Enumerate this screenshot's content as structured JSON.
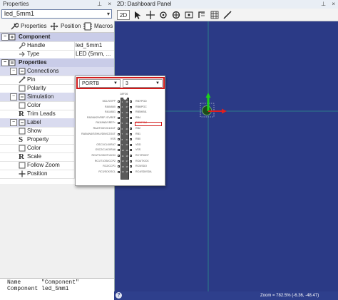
{
  "properties_panel": {
    "title": "Properties",
    "pin_icon": "pin-icon",
    "close_icon": "close-icon",
    "selected_component": "led_5mm1",
    "toolbar": {
      "properties_label": "Properties",
      "position_label": "Position",
      "macros_label": "Macros"
    },
    "rows": {
      "component": "Component",
      "handle_label": "Handle",
      "handle_value": "led_5mm1",
      "type_label": "Type",
      "type_value": "LED (5mm, ...",
      "properties": "Properties",
      "connections": "Connections",
      "pin": "Pin",
      "polarity": "Polarity",
      "simulation": "Simulation",
      "color": "Color",
      "trim_leads": "Trim Leads",
      "label": "Label",
      "show": "Show",
      "property": "Property",
      "label_color": "Color",
      "scale": "Scale",
      "follow_zoom": "Follow Zoom",
      "position": "Position"
    },
    "description": {
      "line1_key": "Name",
      "line1_val": "\"Component\"",
      "line2_key": "Component",
      "line2_val": "led_5mm1"
    }
  },
  "dashboard": {
    "title": "2D: Dashboard Panel",
    "toolbar_label": "2D",
    "status_text": "Zoom = 782.5% (-6.36, -48.47)",
    "canvas_color": "#2b3a86"
  },
  "pin_popup": {
    "port_value": "PORTB",
    "pin_value": "3",
    "chip_name": "18F26",
    "left_pins": [
      "MCLR/VPP",
      "RA0/AN0",
      "RA1/AN1",
      "RA2/AN2/VREF-/CVREF",
      "RA3/AN3/VREF+",
      "RA4/T0CKI/C1OUT",
      "RA5/AN4/SS/HLVDIN/C2OUT",
      "VSS",
      "OSC1/CLKI/RA7",
      "OSC2/CLKO/RA6",
      "RC0/T1OSO/T13CKI",
      "RC1/T1OSI/CCP2",
      "RC2/CCP1",
      "RC3/SCK/SCL"
    ],
    "right_pins": [
      "RB7/PGD",
      "RB6/PGC",
      "RB5/KBI1",
      "RB4",
      "RB3/PGM",
      "RB2",
      "RB1",
      "RB0",
      "VDD",
      "VSS",
      "RC7/RX/DT",
      "RC6/TX/CK",
      "RC5/SDO",
      "RC4/SDI/SDA"
    ],
    "left_nums": [
      "1",
      "2",
      "3",
      "4",
      "5",
      "6",
      "7",
      "8",
      "9",
      "10",
      "11",
      "12",
      "13",
      "14"
    ],
    "right_nums": [
      "28",
      "27",
      "26",
      "25",
      "24",
      "23",
      "22",
      "21",
      "20",
      "19",
      "18",
      "17",
      "16",
      "15"
    ],
    "highlight_color": "#d11a1a"
  }
}
